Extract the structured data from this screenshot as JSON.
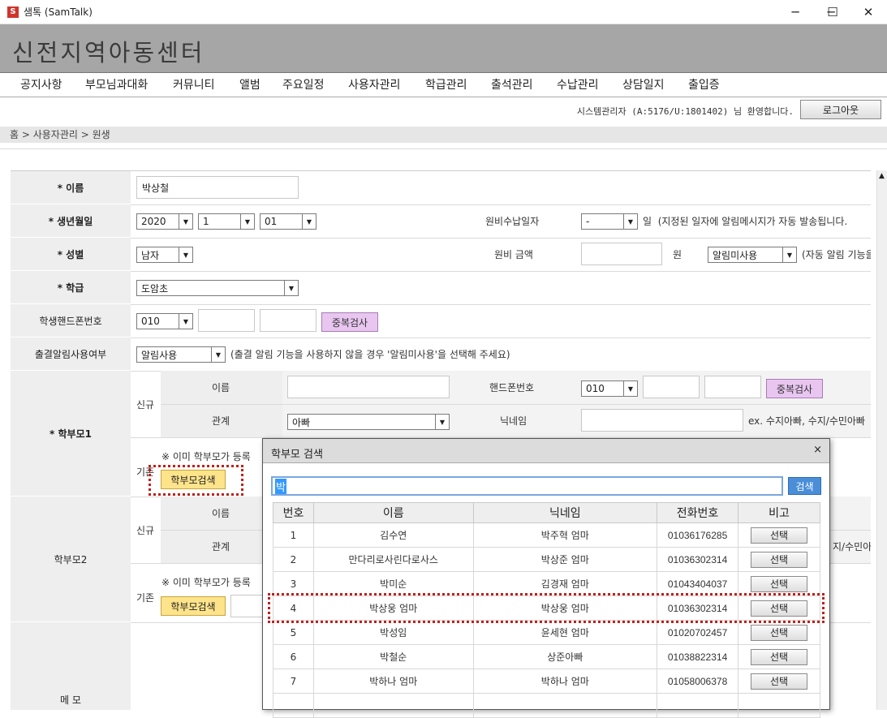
{
  "window": {
    "title": "샘톡 (SamTalk)",
    "app_icon": "samtalk-logo-icon",
    "controls": {
      "minimize": "─",
      "maximize": "☐",
      "close": "✕"
    }
  },
  "banner": {
    "title": "신전지역아동센터"
  },
  "menu": {
    "items": [
      "공지사항",
      "부모님과대화",
      "커뮤니티",
      "앨범",
      "주요일정",
      "사용자관리",
      "학급관리",
      "출석관리",
      "수납관리",
      "상담일지",
      "출입증"
    ]
  },
  "userbar": {
    "welcome": "시스템관리자 (A:5176/U:1801402) 님 환영합니다.",
    "logout": "로그아웃"
  },
  "breadcrumb": "홈 > 사용자관리 > 원생",
  "form": {
    "name": {
      "label": "* 이름",
      "value": "박상철"
    },
    "birth": {
      "label": "* 생년월일",
      "year": "2020",
      "month": "1",
      "day": "01"
    },
    "gender": {
      "label": "* 성별",
      "value": "남자"
    },
    "class": {
      "label": "* 학급",
      "value": "도암초"
    },
    "phone": {
      "label": "학생핸드폰번호",
      "prefix": "010",
      "dup_check": "중복검사"
    },
    "attendance_alert": {
      "label": "출결알림사용여부",
      "value": "알림사용",
      "note": "(출결 알림 기능을 사용하지 않을 경우 '알림미사용'을 선택해 주세요)"
    },
    "fee_date": {
      "label": "원비수납일자",
      "value": "-",
      "unit": "일",
      "note": "(지정된 일자에 알림메시지가 자동 발송됩니다."
    },
    "fee_amount": {
      "label": "원비 금액",
      "unit": "원",
      "alert_value": "알림미사용",
      "note": "(자동 알림 기능을"
    },
    "parent1": {
      "label": "* 학부모1",
      "new": "신규",
      "existing": "기존",
      "name_label": "이름",
      "relation_label": "관계",
      "relation_value": "아빠",
      "phone_label": "핸드폰번호",
      "phone_prefix": "010",
      "dup_check": "중복검사",
      "nickname_label": "닉네임",
      "nickname_hint": "ex. 수지아빠, 수지/수민아빠",
      "registered_note": "※ 이미 학부모가 등록",
      "search_btn": "학부모검색"
    },
    "parent2": {
      "label": "학부모2",
      "new": "신규",
      "existing": "기존",
      "name_label": "이름",
      "relation_label": "관계",
      "nickname_hint": "지/수민아빠",
      "registered_note": "※ 이미 학부모가 등록",
      "search_btn": "학부모검색"
    },
    "memo": {
      "label": "메   모"
    }
  },
  "dialog": {
    "title": "학부모 검색",
    "close": "×",
    "query": "박",
    "search_btn": "검색",
    "columns": [
      "번호",
      "이름",
      "닉네임",
      "전화번호",
      "비고"
    ],
    "select_label": "선택",
    "rows": [
      {
        "no": "1",
        "name": "김수연",
        "nick": "박주혁 엄마",
        "phone": "01036176285"
      },
      {
        "no": "2",
        "name": "만다리로사린다로사스",
        "nick": "박상준 엄마",
        "phone": "01036302314"
      },
      {
        "no": "3",
        "name": "박미순",
        "nick": "김경재 엄마",
        "phone": "01043404037"
      },
      {
        "no": "4",
        "name": "박상웅 엄마",
        "nick": "박상웅 엄마",
        "phone": "01036302314"
      },
      {
        "no": "5",
        "name": "박성임",
        "nick": "윤세현 엄마",
        "phone": "01020702457"
      },
      {
        "no": "6",
        "name": "박철순",
        "nick": "상준아빠",
        "phone": "01038822314"
      },
      {
        "no": "7",
        "name": "박하나 엄마",
        "nick": "박하나 엄마",
        "phone": "01058006378"
      }
    ]
  },
  "colors": {
    "banner": "#a6a6a6",
    "highlight": "#c0201a",
    "search_button": "#4a8ed8",
    "check_button": "#e8c6f0",
    "parent_search_button": "#fde38a"
  }
}
